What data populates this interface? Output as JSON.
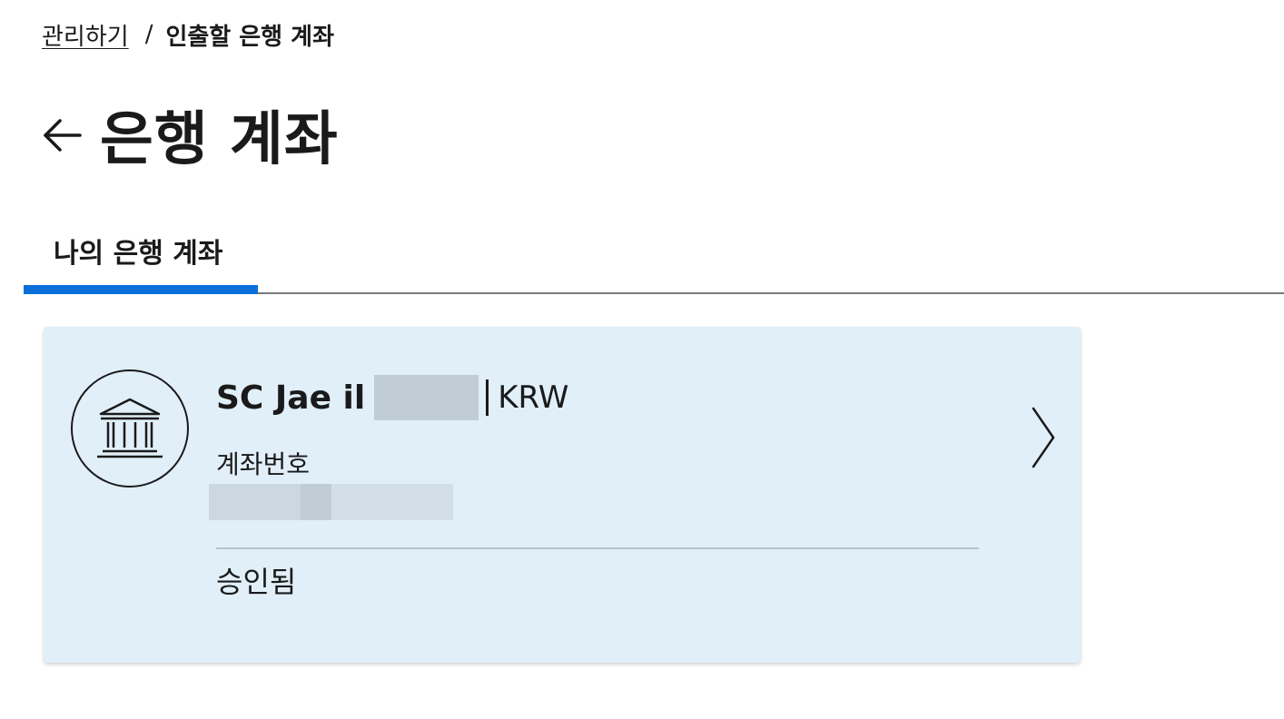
{
  "breadcrumb": {
    "parent": "관리하기",
    "separator": "/",
    "current": "인출할 은행 계좌"
  },
  "page": {
    "title": "은행 계좌",
    "back_icon": "arrow-left-icon"
  },
  "tabs": [
    {
      "label": "나의 은행 계좌",
      "active": true
    }
  ],
  "accent_color": "#0a6fd8",
  "card": {
    "icon": "bank-icon",
    "account_name": "SC Jae il",
    "currency": "KRW",
    "account_number_label": "계좌번호",
    "status": "승인됨",
    "background": "#e1eff9"
  }
}
